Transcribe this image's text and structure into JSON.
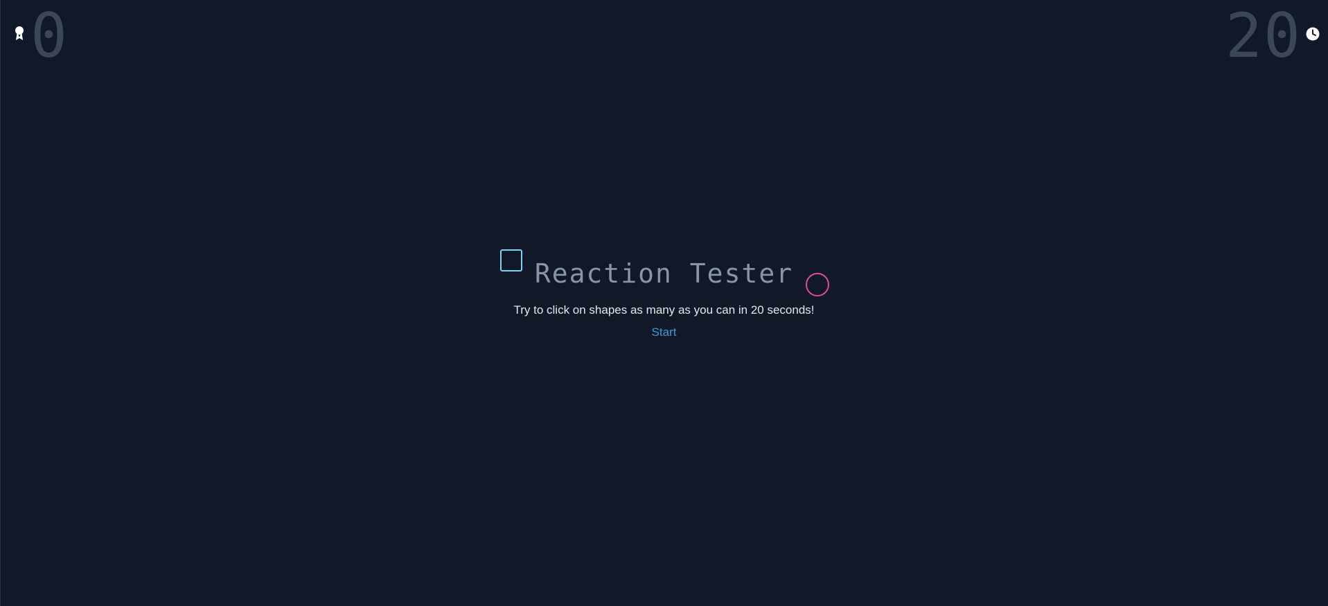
{
  "hud": {
    "score": "0",
    "score_icon": "award-icon",
    "timer": "20",
    "timer_icon": "clock-icon"
  },
  "main": {
    "title": "Reaction Tester",
    "subtitle": "Try to click on shapes as many as you can in 20 seconds!",
    "start_label": "Start"
  },
  "colors": {
    "background": "#111827",
    "square_shape": "#7dd3fc",
    "circle_shape": "#ec4899",
    "link": "#3b9ad9",
    "hud_number": "#3c4656"
  }
}
